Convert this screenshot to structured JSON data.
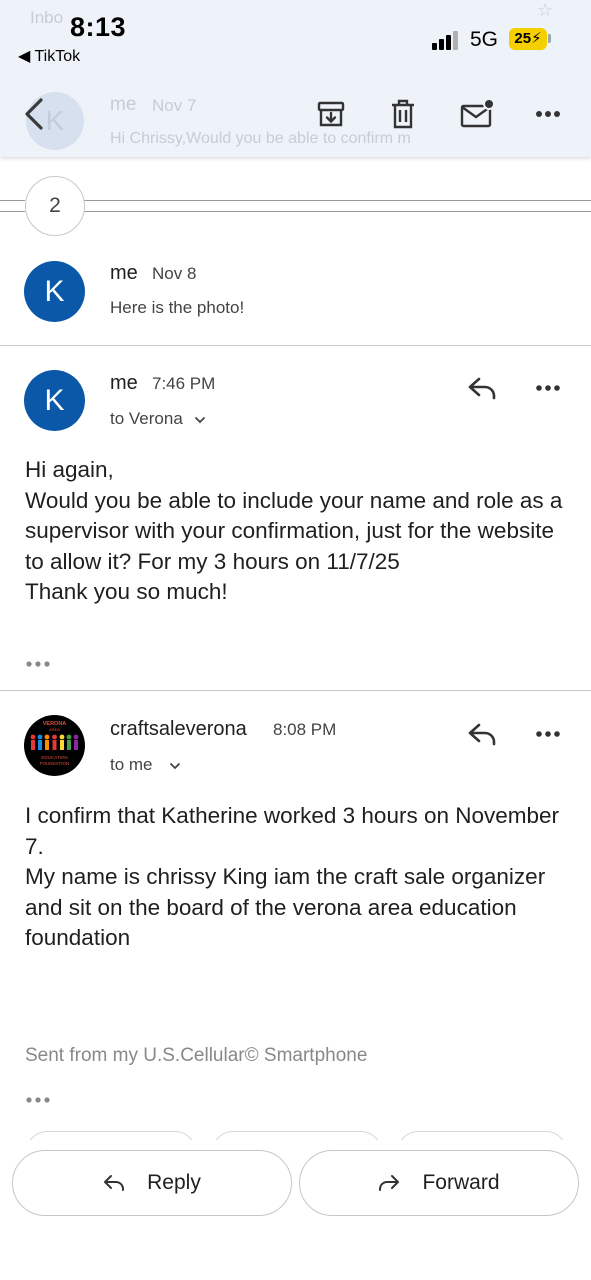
{
  "status_bar": {
    "time": "8:13",
    "back_app": "◀ TikTok",
    "network": "5G",
    "battery": "25⚡"
  },
  "header_ghost": {
    "inbox": "Inbo",
    "sender": "me",
    "date": "Nov 7",
    "preview": "Hi Chrissy,Would you be able to confirm m",
    "avatar_letter": "K"
  },
  "thread": {
    "collapsed_count": "2"
  },
  "messages": [
    {
      "avatar_letter": "K",
      "sender": "me",
      "time": "Nov 8",
      "snippet": "Here is the photo!"
    },
    {
      "avatar_letter": "K",
      "sender": "me",
      "time": "7:46 PM",
      "recipient": "to Verona",
      "body": [
        "Hi again,",
        "Would you be able to include your name and role as a supervisor with your confirmation, just for the website to allow it? For my 3 hours on 11/7/25",
        "Thank you so much!"
      ]
    },
    {
      "sender": "craftsaleverona",
      "time": "8:08 PM",
      "recipient": "to me",
      "logo_text": {
        "top": "VERONA",
        "mid": "AREA",
        "bottom1": "EDUCATION",
        "bottom2": "FOUNDATION"
      },
      "body": [
        "I confirm that Katherine worked 3 hours on November 7.",
        "My name is chrissy King iam the craft sale organizer and sit on the board of the verona area education foundation"
      ],
      "signature": "Sent from my U.S.Cellular© Smartphone"
    }
  ],
  "actions": {
    "reply": "Reply",
    "forward": "Forward"
  },
  "colors": {
    "avatar": "#0b57a8",
    "header_bg": "#eef2f9",
    "battery": "#f5d000"
  }
}
